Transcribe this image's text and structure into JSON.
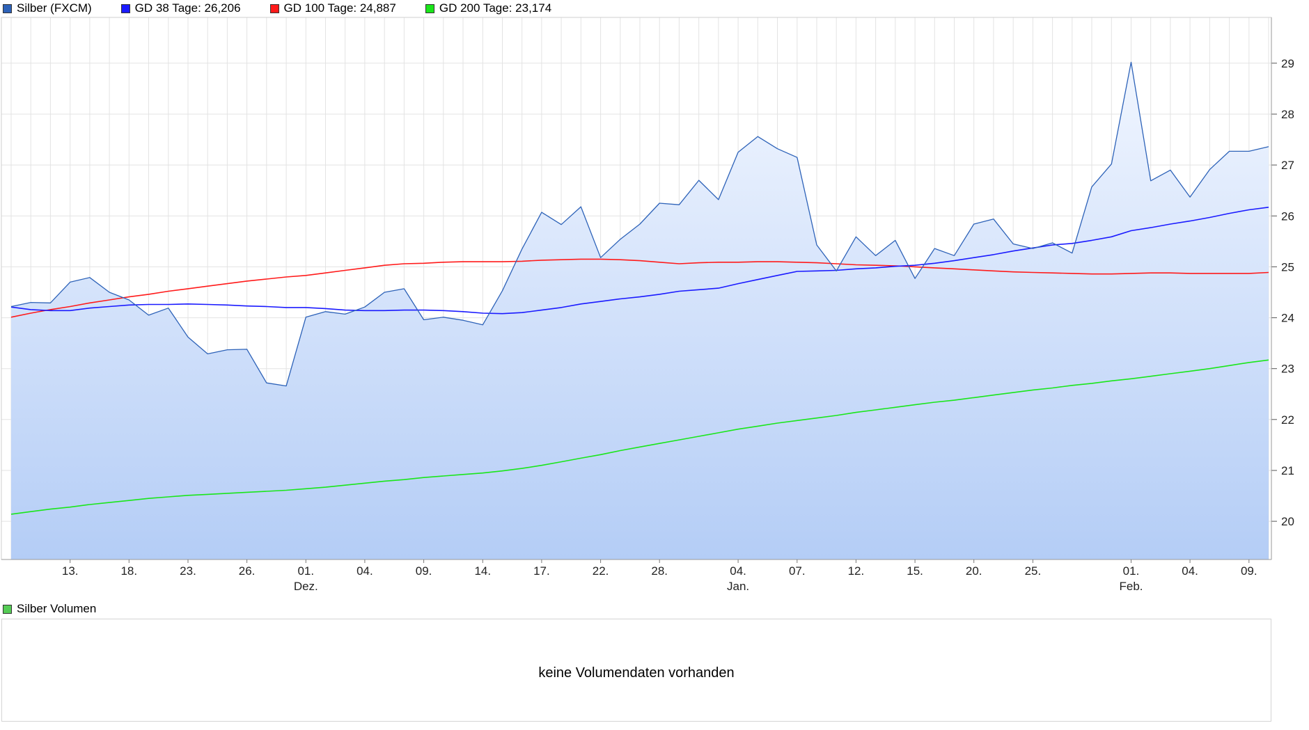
{
  "legend_main": [
    {
      "label": "Silber (FXCM)",
      "color": "#2d62b8"
    },
    {
      "label": "GD 38 Tage: 26,206",
      "color": "#1a1aff"
    },
    {
      "label": "GD 100 Tage: 24,887",
      "color": "#ff1a1a"
    },
    {
      "label": "GD 200 Tage: 23,174",
      "color": "#1ae61a"
    }
  ],
  "legend_volume": {
    "label": "Silber Volumen",
    "color": "#55cc55"
  },
  "volume_message": "keine Volumendaten vorhanden",
  "chart_data": {
    "type": "line",
    "title": "",
    "ylim": [
      19.25,
      29.9
    ],
    "y_ticks": [
      20,
      21,
      22,
      23,
      24,
      25,
      26,
      27,
      28,
      29
    ],
    "grid": true,
    "x_tick_labels": [
      {
        "i": 3,
        "label": "13."
      },
      {
        "i": 6,
        "label": "18."
      },
      {
        "i": 9,
        "label": "23."
      },
      {
        "i": 12,
        "label": "26."
      },
      {
        "i": 15,
        "label": "01.",
        "sub": "Dez."
      },
      {
        "i": 18,
        "label": "04."
      },
      {
        "i": 21,
        "label": "09."
      },
      {
        "i": 24,
        "label": "14."
      },
      {
        "i": 27,
        "label": "17."
      },
      {
        "i": 30,
        "label": "22."
      },
      {
        "i": 33,
        "label": "28."
      },
      {
        "i": 37,
        "label": "04.",
        "sub": "Jan."
      },
      {
        "i": 40,
        "label": "07."
      },
      {
        "i": 43,
        "label": "12."
      },
      {
        "i": 46,
        "label": "15."
      },
      {
        "i": 49,
        "label": "20."
      },
      {
        "i": 52,
        "label": "25."
      },
      {
        "i": 57,
        "label": "01.",
        "sub": "Feb."
      },
      {
        "i": 60,
        "label": "04."
      },
      {
        "i": 63,
        "label": "09."
      }
    ],
    "series": [
      {
        "name": "Silber (FXCM)",
        "color": "#2d62b8",
        "fill": true,
        "values": [
          24.22,
          24.3,
          24.29,
          24.7,
          24.79,
          24.5,
          24.35,
          24.05,
          24.19,
          23.62,
          23.29,
          23.37,
          23.38,
          22.72,
          22.66,
          24.01,
          24.12,
          24.07,
          24.21,
          24.5,
          24.57,
          23.96,
          24.01,
          23.95,
          23.86,
          24.53,
          25.35,
          26.07,
          25.83,
          26.18,
          25.18,
          25.54,
          25.84,
          26.25,
          26.22,
          26.7,
          26.32,
          27.25,
          27.56,
          27.32,
          27.15,
          25.43,
          24.92,
          25.59,
          25.22,
          25.52,
          24.77,
          25.36,
          25.22,
          25.84,
          25.94,
          25.45,
          25.36,
          25.47,
          25.27,
          26.57,
          27.02,
          29.02,
          26.69,
          26.9,
          26.37,
          26.91,
          27.27,
          27.27,
          27.36
        ]
      },
      {
        "name": "GD 38 Tage: 26,206",
        "color": "#1a1aff",
        "values": [
          24.21,
          24.16,
          24.14,
          24.14,
          24.19,
          24.22,
          24.25,
          24.26,
          24.26,
          24.27,
          24.26,
          24.25,
          24.23,
          24.22,
          24.2,
          24.2,
          24.18,
          24.15,
          24.14,
          24.14,
          24.15,
          24.15,
          24.14,
          24.12,
          24.09,
          24.08,
          24.1,
          24.15,
          24.2,
          24.27,
          24.32,
          24.37,
          24.41,
          24.46,
          24.52,
          24.55,
          24.58,
          24.67,
          24.75,
          24.83,
          24.91,
          24.92,
          24.93,
          24.96,
          24.98,
          25.01,
          25.03,
          25.07,
          25.12,
          25.18,
          25.24,
          25.31,
          25.37,
          25.43,
          25.46,
          25.52,
          25.59,
          25.71,
          25.77,
          25.84,
          25.9,
          25.97,
          26.05,
          26.12,
          26.17
        ]
      },
      {
        "name": "GD 100 Tage: 24,887",
        "color": "#ff1a1a",
        "values": [
          24.01,
          24.09,
          24.16,
          24.22,
          24.29,
          24.35,
          24.41,
          24.46,
          24.52,
          24.57,
          24.62,
          24.67,
          24.72,
          24.76,
          24.8,
          24.83,
          24.88,
          24.93,
          24.98,
          25.03,
          25.06,
          25.07,
          25.09,
          25.1,
          25.1,
          25.1,
          25.11,
          25.13,
          25.14,
          25.15,
          25.15,
          25.14,
          25.12,
          25.09,
          25.06,
          25.08,
          25.09,
          25.09,
          25.1,
          25.1,
          25.09,
          25.08,
          25.06,
          25.04,
          25.03,
          25.02,
          25.0,
          24.98,
          24.96,
          24.94,
          24.92,
          24.9,
          24.89,
          24.88,
          24.87,
          24.86,
          24.86,
          24.87,
          24.88,
          24.88,
          24.87,
          24.87,
          24.87,
          24.87,
          24.89
        ]
      },
      {
        "name": "GD 200 Tage: 23,174",
        "color": "#1ae61a",
        "values": [
          20.14,
          20.19,
          20.24,
          20.28,
          20.33,
          20.37,
          20.41,
          20.45,
          20.48,
          20.51,
          20.53,
          20.55,
          20.57,
          20.59,
          20.61,
          20.64,
          20.67,
          20.71,
          20.75,
          20.79,
          20.82,
          20.86,
          20.89,
          20.92,
          20.95,
          20.99,
          21.04,
          21.1,
          21.17,
          21.24,
          21.31,
          21.39,
          21.46,
          21.53,
          21.6,
          21.67,
          21.74,
          21.81,
          21.87,
          21.93,
          21.98,
          22.03,
          22.08,
          22.14,
          22.19,
          22.24,
          22.29,
          22.34,
          22.38,
          22.43,
          22.48,
          22.53,
          22.58,
          22.62,
          22.67,
          22.71,
          22.76,
          22.8,
          22.85,
          22.9,
          22.95,
          23.0,
          23.06,
          23.12,
          23.17
        ]
      }
    ]
  }
}
